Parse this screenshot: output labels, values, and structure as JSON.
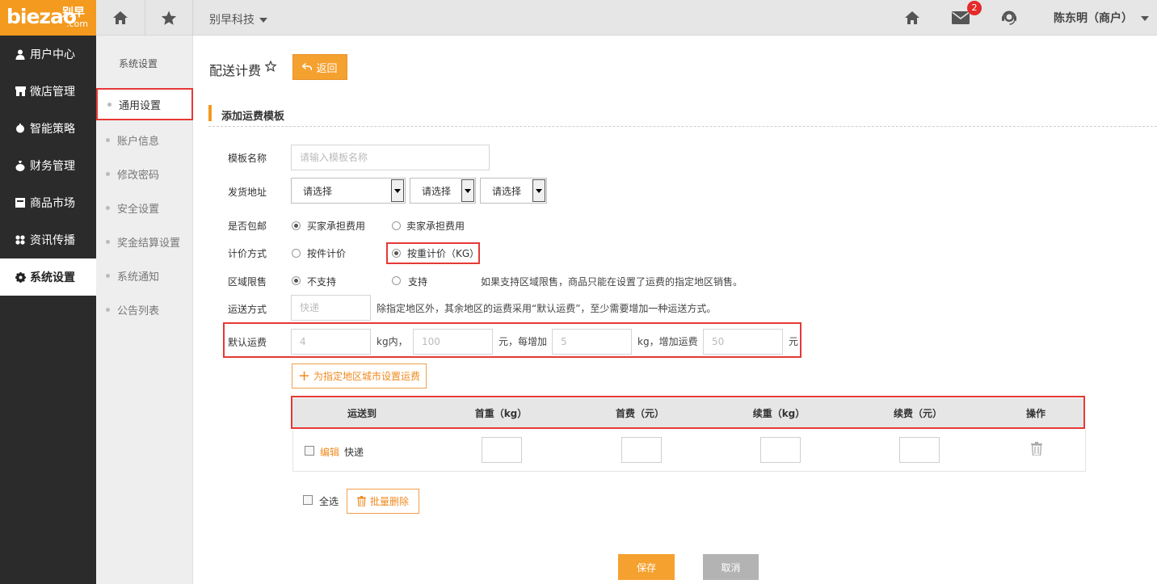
{
  "logo": {
    "latin": "biezao",
    "cn": "别早",
    "com": ".com"
  },
  "topbar": {
    "company": "别早科技",
    "mail_badge": "2",
    "user": "陈东明（商户）"
  },
  "leftnav": {
    "items": [
      {
        "label": "用户中心",
        "icon": "user-icon"
      },
      {
        "label": "微店管理",
        "icon": "store-icon"
      },
      {
        "label": "智能策略",
        "icon": "strategy-icon"
      },
      {
        "label": "财务管理",
        "icon": "money-bag-icon"
      },
      {
        "label": "商品市场",
        "icon": "market-icon"
      },
      {
        "label": "资讯传播",
        "icon": "grid-icon"
      },
      {
        "label": "系统设置",
        "icon": "gear-icon"
      }
    ],
    "active": "系统设置"
  },
  "subnav": {
    "title": "系统设置",
    "items": [
      {
        "label": "通用设置"
      },
      {
        "label": "账户信息"
      },
      {
        "label": "修改密码"
      },
      {
        "label": "安全设置"
      },
      {
        "label": "奖金结算设置"
      },
      {
        "label": "系统通知"
      },
      {
        "label": "公告列表"
      }
    ],
    "active": "通用设置"
  },
  "main": {
    "title": "配送计费",
    "back_label": "返回",
    "section_title": "添加运费模板",
    "form": {
      "name_label": "模板名称",
      "name_placeholder": "请输入模板名称",
      "address_label": "发货地址",
      "address_selects": [
        "请选择",
        "请选择",
        "请选择"
      ],
      "free_shipping_label": "是否包邮",
      "free_shipping_options": [
        "买家承担费用",
        "卖家承担费用"
      ],
      "free_shipping_selected": "买家承担费用",
      "pricing_label": "计价方式",
      "pricing_options": [
        "按件计价",
        "按重计价（KG）"
      ],
      "pricing_selected": "按重计价（KG）",
      "region_label": "区域限售",
      "region_options": [
        "不支持",
        "支持"
      ],
      "region_selected": "不支持",
      "region_hint": "如果支持区域限售，商品只能在设置了运费的指定地区销售。",
      "method_label": "运送方式",
      "method_placeholder": "快递",
      "method_hint": "除指定地区外，其余地区的运费采用“默认运费”，至少需要增加一种运送方式。",
      "default_fee_label": "默认运费",
      "default_fee": {
        "weight": "4",
        "weight_unit": "kg内，",
        "fee": "100",
        "fee_unit": "元，每增加",
        "extra_weight": "5",
        "extra_weight_unit": "kg，增加运费",
        "extra_fee": "50",
        "extra_fee_unit": "元"
      },
      "add_area_label": "为指定地区城市设置运费"
    },
    "table": {
      "columns": [
        "运送到",
        "首重（kg）",
        "首费（元）",
        "续重（kg）",
        "续费（元）",
        "操作"
      ],
      "rows": [
        {
          "edit": "编辑",
          "type": "快递"
        }
      ]
    },
    "select_all_label": "全选",
    "batch_delete_label": "批量删除",
    "save_label": "保存",
    "cancel_label": "取消"
  }
}
